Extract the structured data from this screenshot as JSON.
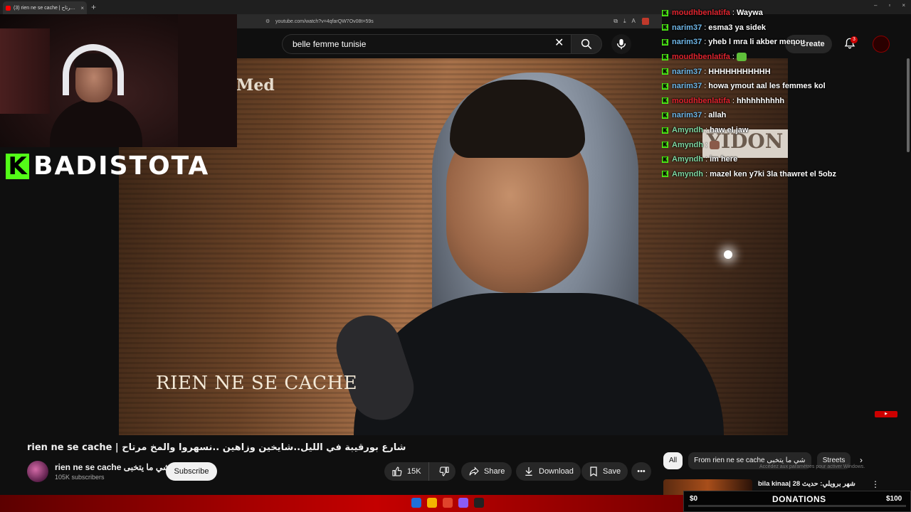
{
  "browser": {
    "tab_title": "(3) rien ne se cache | شارع مرتاح",
    "tab_close": "×",
    "new_tab": "+",
    "url": "youtube.com/watch?v=4qfarQW7Ov08t=59s",
    "window_controls": [
      "–",
      "▫",
      "×"
    ]
  },
  "youtube": {
    "search_value": "belle femme tunisie",
    "create_label": "Create",
    "notification_count": "3"
  },
  "video": {
    "caption_text": "RIEN NE SE CACHE",
    "watermark_text": "Med",
    "sign_text": "YIDON",
    "title": "rien ne se cache | شارع بورقيبة في الليل..شايخين وزاهين ..نسهروا والمخ مرتاح",
    "channel_name": "rien ne se cache شي ما يتخبى",
    "subscribers": "105K subscribers",
    "subscribe_label": "Subscribe",
    "like_count": "15K",
    "share_label": "Share",
    "download_label": "Download",
    "save_label": "Save"
  },
  "stream": {
    "brand_letter": "K",
    "brand_name": "BADISTOTA"
  },
  "chat": {
    "messages": [
      {
        "user": "moudhbenlatifa",
        "color": "#e0242e",
        "text": "Waywa"
      },
      {
        "user": "narim37",
        "color": "#6fb7e8",
        "text": "esma3 ya sidek"
      },
      {
        "user": "narim37",
        "color": "#6fb7e8",
        "text": "yheb l mra li akber menou"
      },
      {
        "user": "moudhbenlatifa",
        "color": "#e0242e",
        "text": ""
      },
      {
        "user": "narim37",
        "color": "#6fb7e8",
        "text": "HHHHHHHHHHH"
      },
      {
        "user": "narim37",
        "color": "#6fb7e8",
        "text": "howa ymout aal les femmes kol"
      },
      {
        "user": "moudhbenlatifa",
        "color": "#e0242e",
        "text": "hhhhhhhhhh"
      },
      {
        "user": "narim37",
        "color": "#6fb7e8",
        "text": "allah"
      },
      {
        "user": "Amyndh",
        "color": "#7fd6a0",
        "text": "haw el jaw"
      },
      {
        "user": "Amyndh",
        "color": "#7fd6a0",
        "text": ""
      },
      {
        "user": "Amyndh",
        "color": "#7fd6a0",
        "text": "im here"
      },
      {
        "user": "Amyndh",
        "color": "#7fd6a0",
        "text": "mazel ken y7ki 3la thawret el 5obz"
      }
    ],
    "separator": ":"
  },
  "sidebar": {
    "chips": [
      "All",
      "From rien ne se cache شي ما يتخبى",
      "Streets"
    ],
    "windows_notice": "Accédez aux paramètres pour activer Windows.",
    "recommendation_title": "bila kinaa| 28 شهر برويلي: حديث"
  },
  "donations": {
    "raised": "$0",
    "label": "DONATIONS",
    "goal": "$100",
    "progress": 0
  },
  "colors": {
    "kick_green": "#53fc18",
    "youtube_red": "#ff0000",
    "background": "#0f0f0f"
  }
}
